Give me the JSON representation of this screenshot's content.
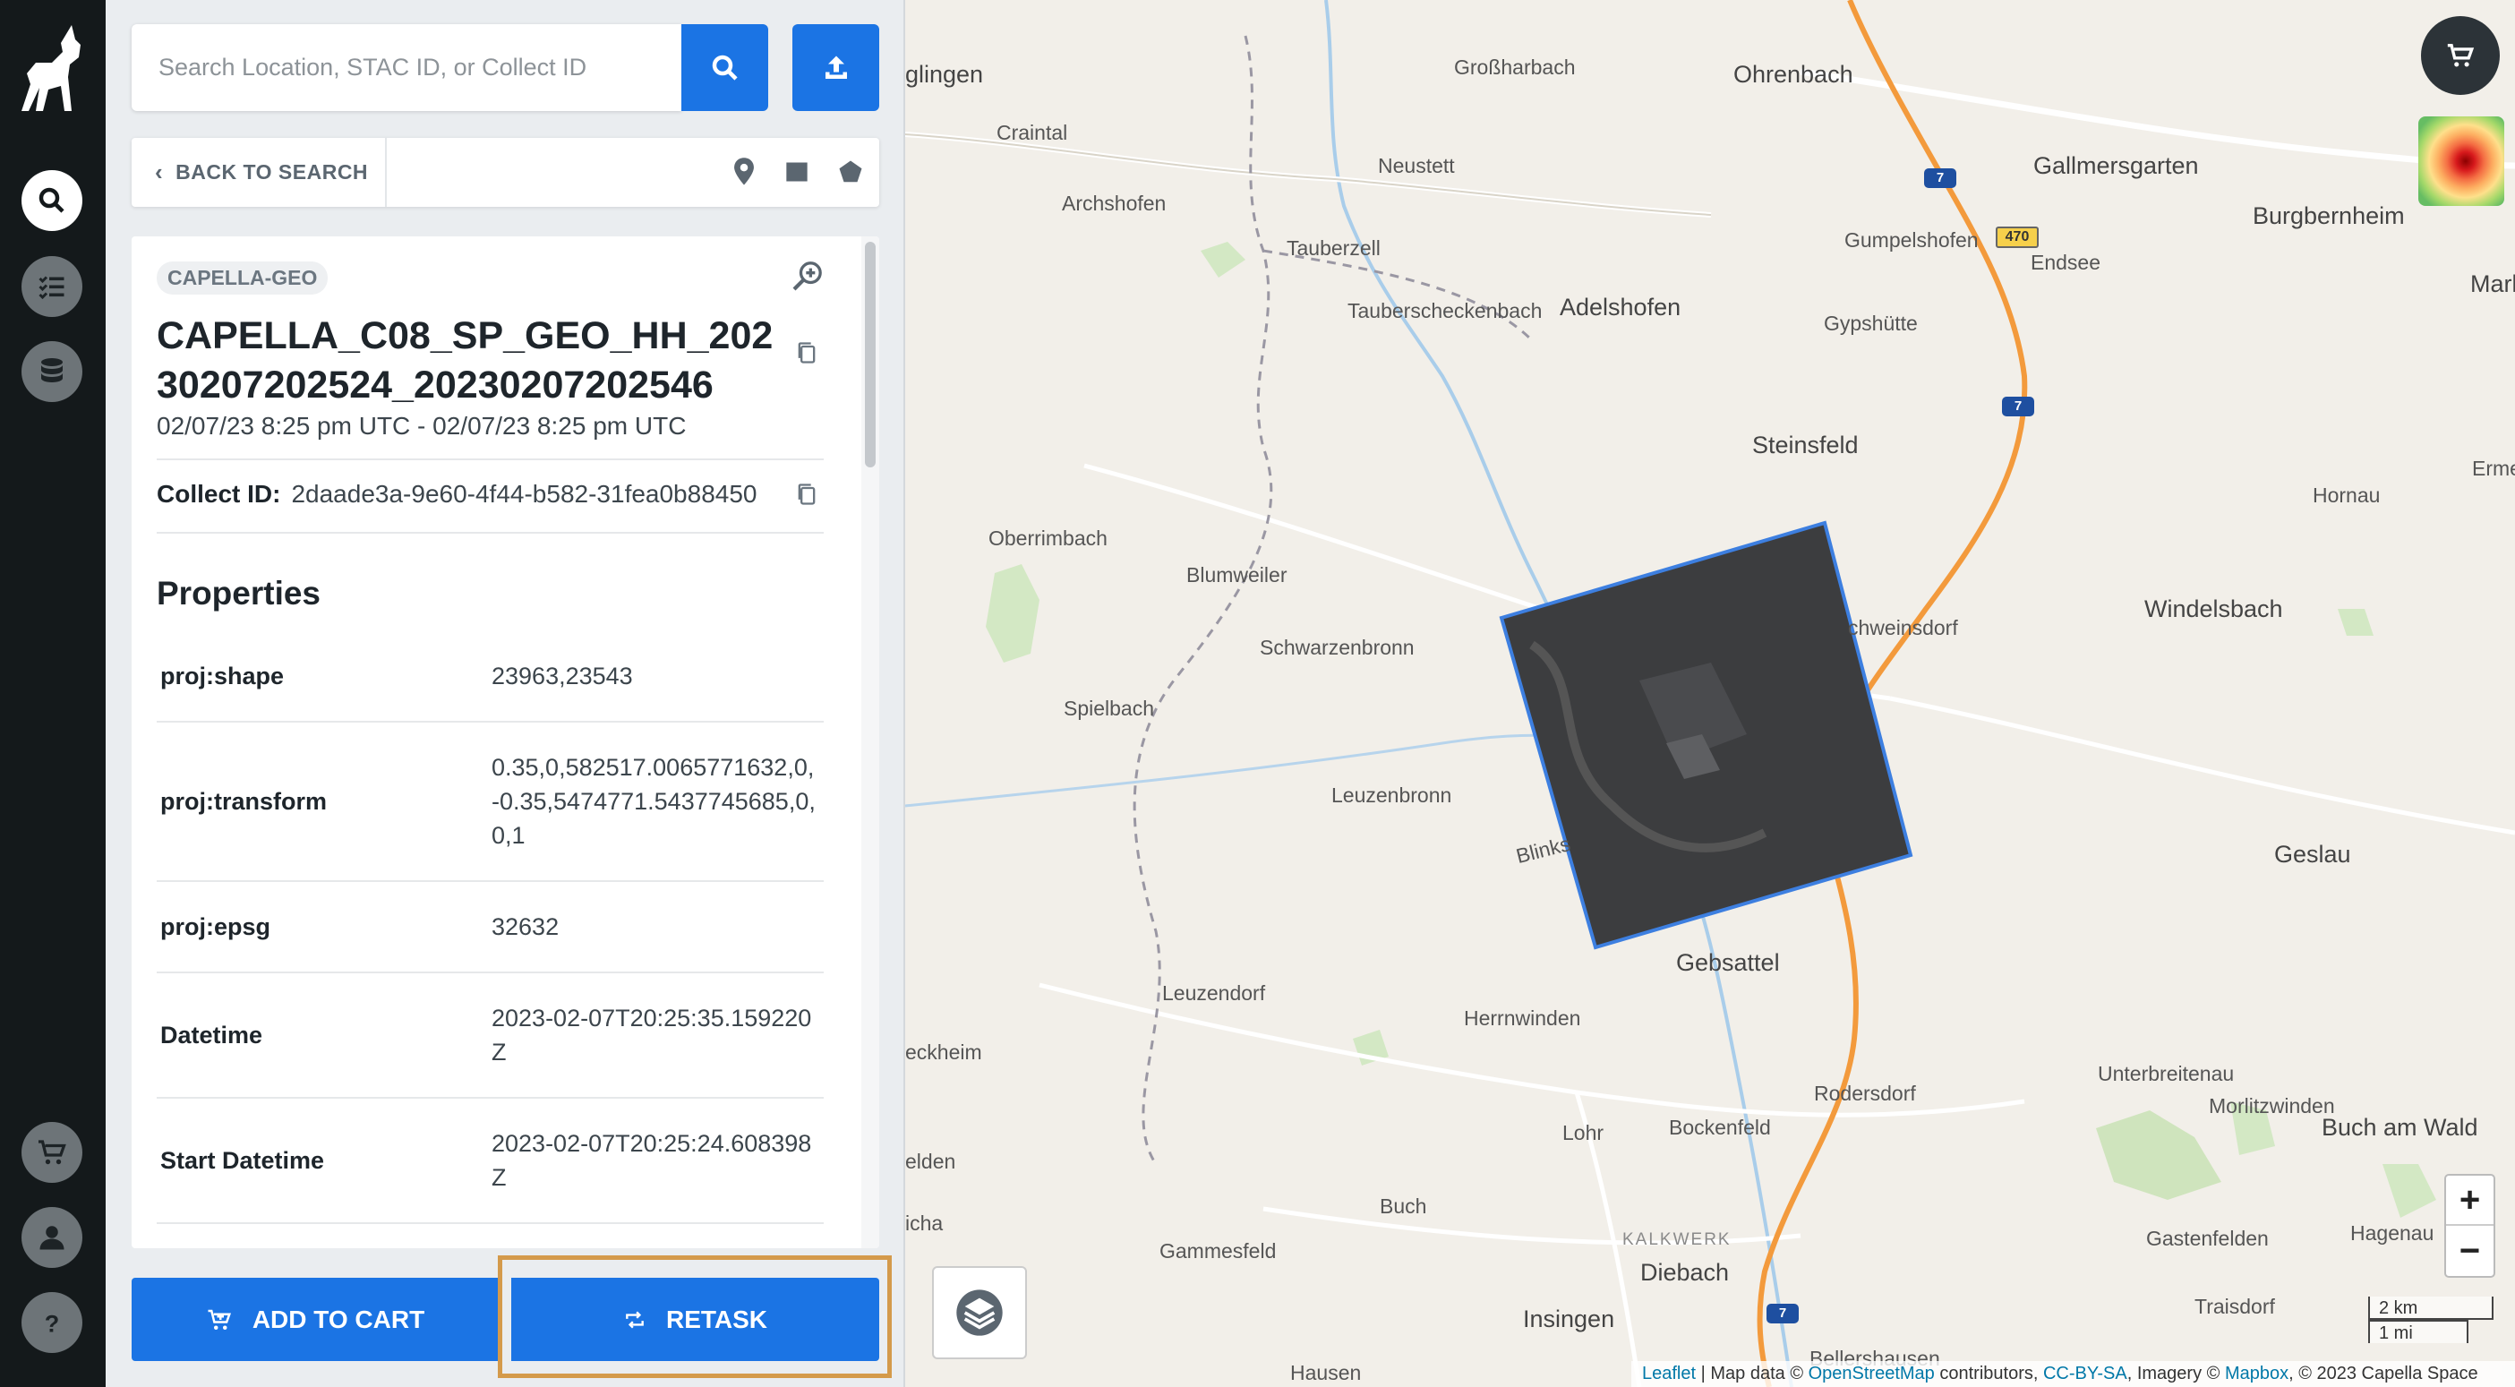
{
  "rail": {
    "items": [
      {
        "icon": "search-icon",
        "active": true
      },
      {
        "icon": "task-list-icon",
        "active": false
      },
      {
        "icon": "database-icon",
        "active": false
      },
      {
        "icon": "cart-icon",
        "active": false
      },
      {
        "icon": "user-icon",
        "active": false
      },
      {
        "icon": "help-icon",
        "active": false
      }
    ]
  },
  "search": {
    "placeholder": "Search Location, STAC ID, or Collect ID",
    "value": ""
  },
  "toolbar": {
    "back_label": "BACK TO SEARCH",
    "tools": [
      "pin-icon",
      "rectangle-icon",
      "polygon-icon"
    ]
  },
  "detail": {
    "tag": "CAPELLA-GEO",
    "title": "CAPELLA_C08_SP_GEO_HH_20230207202524_20230207202546",
    "dates": "02/07/23 8:25 pm UTC - 02/07/23 8:25 pm UTC",
    "collect_id_label": "Collect ID:",
    "collect_id": "2daade3a-9e60-4f44-b582-31fea0b88450",
    "properties_heading": "Properties",
    "properties": [
      {
        "key": "proj:shape",
        "value": "23963,23543"
      },
      {
        "key": "proj:transform",
        "value": "0.35,0,582517.0065771632,0,-0.35,5474771.5437745685,0,0,1"
      },
      {
        "key": "proj:epsg",
        "value": "32632"
      },
      {
        "key": "Datetime",
        "value": "2023-02-07T20:25:35.159220Z"
      },
      {
        "key": "Start Datetime",
        "value": "2023-02-07T20:25:24.608398Z"
      }
    ]
  },
  "actions": {
    "add_to_cart": "ADD TO CART",
    "retask": "RETASK"
  },
  "map": {
    "places": [
      "glingen",
      "Großharbach",
      "Ohrenbach",
      "Craintal",
      "Gallmersgarten",
      "Neustett",
      "Burgbernheim",
      "Archshofen",
      "Marktb",
      "Tauberzell",
      "Gumpelshofen",
      "Endsee",
      "Tauberscheckenbach",
      "Adelshofen",
      "Gypshütte",
      "Steinsfeld",
      "Ermet",
      "Hornau",
      "Oberrimbach",
      "Blumweiler",
      "Windelsbach",
      "chweinsdorf",
      "Schwarzenbronn",
      "Spielbach",
      "Leuzenbronn",
      "Geslau",
      "Blinks",
      "Gebsattel",
      "Leuzendorf",
      "Herrnwinden",
      "eckheim",
      "Unterbreitenau",
      "Rodersdorf",
      "Morlitzwinden",
      "Lohr",
      "Bockenfeld",
      "Buch am Wald",
      "elden",
      "Buch",
      "icha",
      "Gammesfeld",
      "KALKWERK",
      "Gastenfelden",
      "Hagenau",
      "Diebach",
      "Traisdorf",
      "Insingen",
      "Bellershausen",
      "Hausen"
    ],
    "highways": [
      "7",
      "470"
    ],
    "zoom_in": "+",
    "zoom_out": "−",
    "scale_km": "2 km",
    "scale_mi": "1 mi",
    "attribution": {
      "leaflet": "Leaflet",
      "text1": " | Map data © ",
      "osm": "OpenStreetMap",
      "text2": " contributors, ",
      "ccbysa": "CC-BY-SA",
      "text3": ", Imagery © ",
      "mapbox": "Mapbox",
      "text4": ", © 2023 Capella Space"
    }
  },
  "colors": {
    "accent": "#1b74e4",
    "rail": "#14191b",
    "highlight": "#d49a4b",
    "route": "#f39a3c"
  }
}
